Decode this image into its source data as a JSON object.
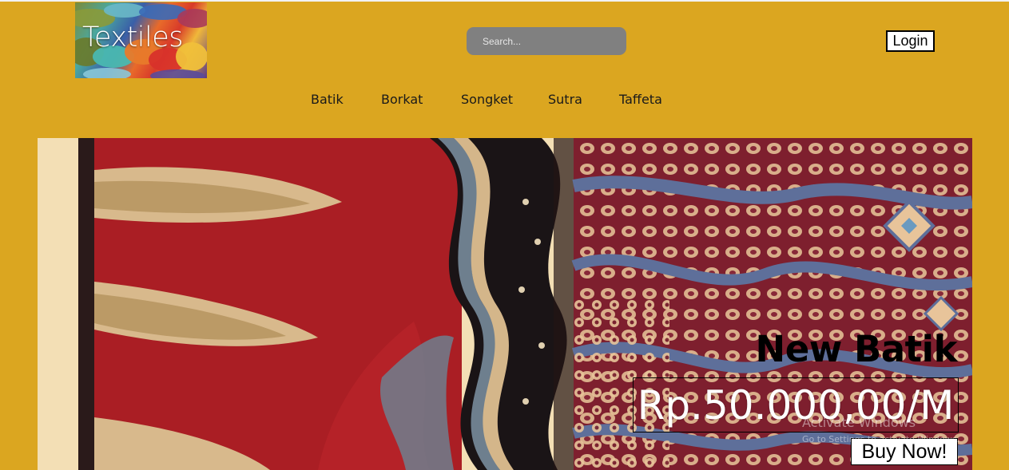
{
  "header": {
    "logo_text": "Textiles",
    "login_label": "Login"
  },
  "search": {
    "placeholder": "Search..."
  },
  "nav": {
    "items": [
      {
        "label": "Batik"
      },
      {
        "label": "Borkat"
      },
      {
        "label": "Songket"
      },
      {
        "label": "Sutra"
      },
      {
        "label": "Taffeta"
      }
    ]
  },
  "hero": {
    "title": "New Batik",
    "price": "Rp.50.000,00/M",
    "buy_label": "Buy Now!"
  },
  "watermark": {
    "line1": "Activate Windows",
    "line2": "Go to Settings to activate Windows."
  },
  "colors": {
    "page_background": "#dba620",
    "hero_side_panel": "#f3dfb5",
    "search_background": "#808080"
  }
}
